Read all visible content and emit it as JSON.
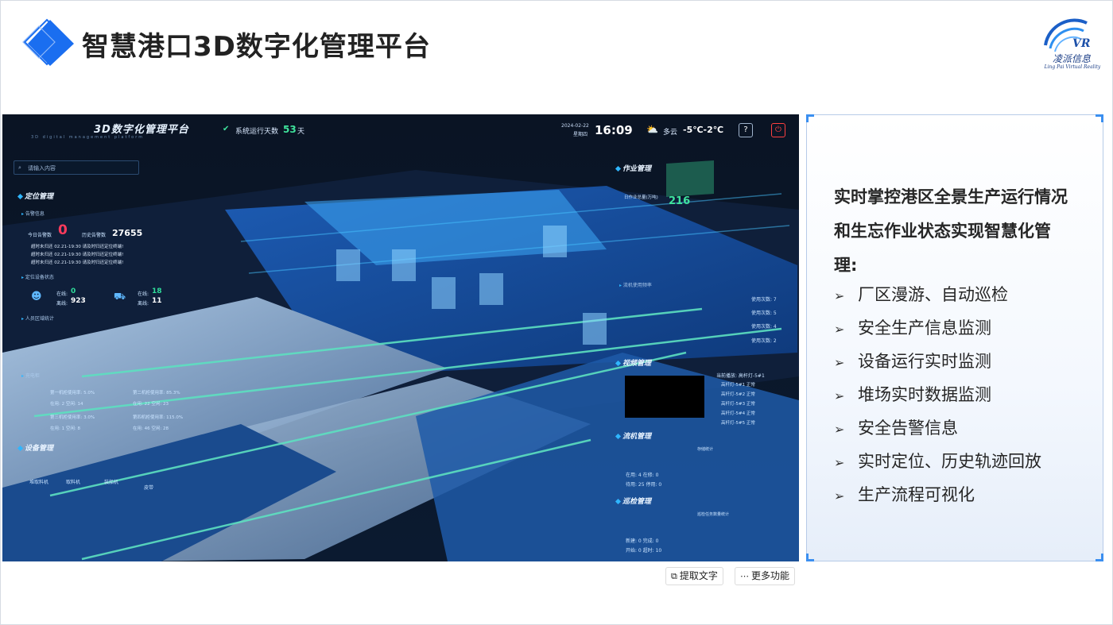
{
  "header": {
    "title": "智慧港口3D数字化管理平台",
    "brand_name": "凌派信息",
    "brand_sub": "Ling Pai Virtual Reality",
    "icons": [
      "diamond-logo-icon",
      "brand-logo-icon"
    ],
    "accent_color": "#1a6ef0"
  },
  "shot": {
    "title": "3D数字化管理平台",
    "title_sub": "3D digital management platform",
    "runtime_label": "系统运行天数",
    "runtime_value": "53",
    "runtime_unit": "天",
    "date": "2024-02-22",
    "weekday": "星期四",
    "time": "16:09",
    "weather": "多云",
    "temperature": "-5℃-2℃",
    "search_placeholder": "请输入内容",
    "left": {
      "positioning": "定位管理",
      "alarm_info": "告警信息",
      "today_alarms_label": "今日告警数",
      "today_alarms_value": "0",
      "history_alarms_label": "历史告警数",
      "history_alarms_value": "27655",
      "alarms": [
        "超时未归还    02.21-19:30    请及时归还定位终端!",
        "超时未归还    02.21-19:30    请及时归还定位终端!",
        "超时未归还    02.21-19:30    请及时归还定位终端!"
      ],
      "device_status": "定位设备状态",
      "online_label": "在线:",
      "offline_label": "离线:",
      "person_online": "0",
      "person_offline": "923",
      "vehicle_online": "18",
      "vehicle_offline": "11",
      "personnel_area": "人员区域统计",
      "charger": "充电柜",
      "charger_rows": [
        "第一机柜使用率: 5.0%",
        "在用: 2    空闲: 14",
        "第三机柜使用率: 3.0%",
        "在用: 1    空闲: 8",
        "第二机柜使用率: 85.3%",
        "在用: 22    空闲: 23",
        "第四机柜使用率: 115.0%",
        "在用: 46    空闲: 28"
      ],
      "equipment": "设备管理",
      "equipment_items": [
        "堆取料机",
        "取料机",
        "装船机",
        "皮带"
      ]
    },
    "right": {
      "operations": "作业管理",
      "count_label": "日作业总量(万吨)",
      "count_value": "216",
      "usage": "流机使用频率",
      "usage_rows": [
        "使用次数: 7",
        "使用次数: 5",
        "使用次数: 4",
        "使用次数: 2"
      ],
      "video": "视频管理",
      "camera": "当前播放: 高杆灯-5#1",
      "cameras": [
        "高杆灯-5#1   正常",
        "高杆灯-5#2   正常",
        "高杆灯-5#3   正常",
        "高杆灯-5#4   正常",
        "高杆灯-5#5   正常"
      ],
      "flow": "流机管理",
      "flow_rows": [
        "在用: 4    在修: 0",
        "待用: 25    停用: 0"
      ],
      "storage_label": "存储统计",
      "inspection": "巡检管理",
      "inspection_rows": [
        "新建: 0    完成: 0",
        "开始: 0    超时: 10"
      ],
      "inspection_chart_label": "巡检任务数量统计"
    }
  },
  "side": {
    "intro": "实时掌控港区全景生产运行情况和生忘作业状态实现智慧化管理:",
    "features": [
      "厂区漫游、自动巡检",
      "安全生产信息监测",
      "设备运行实时监测",
      "堆场实时数据监测",
      "安全告警信息",
      "实时定位、历史轨迹回放",
      "生产流程可视化"
    ]
  },
  "toolbar": {
    "extract_text": "提取文字",
    "more": "更多功能"
  }
}
